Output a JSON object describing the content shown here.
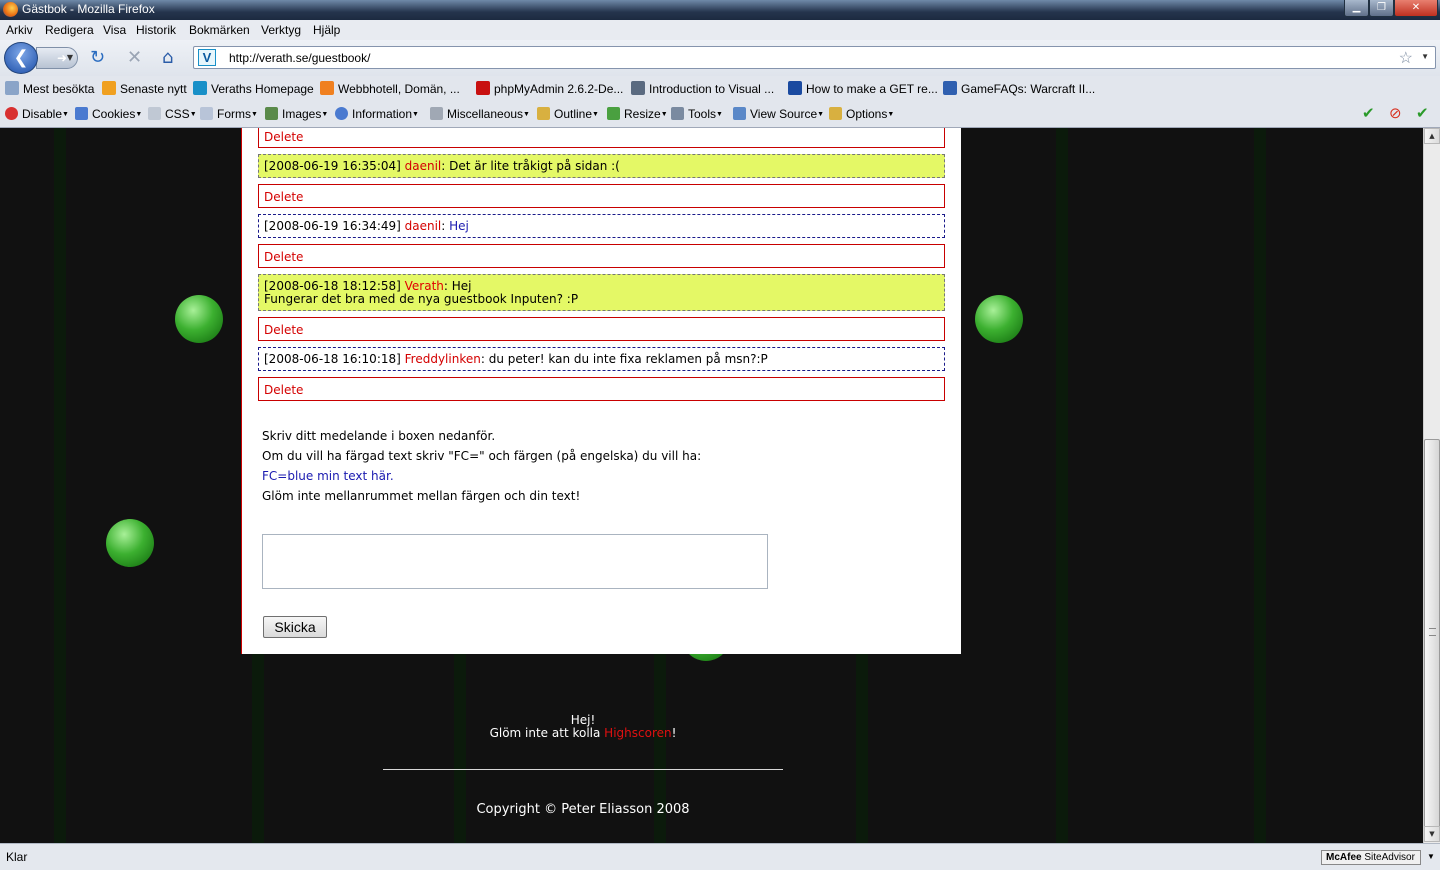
{
  "window": {
    "title": "Gästbok - Mozilla Firefox"
  },
  "menu": [
    "Arkiv",
    "Redigera",
    "Visa",
    "Historik",
    "Bokmärken",
    "Verktyg",
    "Hjälp"
  ],
  "nav": {
    "url": "http://verath.se/guestbook/"
  },
  "bookmarks": [
    "Mest besökta",
    "Senaste nytt",
    "Veraths Homepage",
    "Webbhotell, Domän, ...",
    "phpMyAdmin 2.6.2-De...",
    "Introduction to Visual ...",
    "How to make a GET re...",
    "GameFAQs: Warcraft II..."
  ],
  "devtoolbar": [
    "Disable",
    "Cookies",
    "CSS",
    "Forms",
    "Images",
    "Information",
    "Miscellaneous",
    "Outline",
    "Resize",
    "Tools",
    "View Source",
    "Options"
  ],
  "guestbook": {
    "delete_label": "Delete",
    "entries": [
      {
        "timestamp": "[2008-06-19 16:35:04]",
        "name": "daenil",
        "text": ": Det är lite tråkigt på sidan :("
      },
      {
        "timestamp": "[2008-06-19 16:34:49]",
        "name": "daenil",
        "sep": ": ",
        "text": "Hej"
      },
      {
        "timestamp": "[2008-06-18 18:12:58]",
        "name": "Verath",
        "text": ": Hej",
        "text2": "Fungerar det bra med de nya guestbook Inputen? :P"
      },
      {
        "timestamp": "[2008-06-18 16:10:18]",
        "name": "Freddylinken",
        "text": ": du peter! kan du inte fixa reklamen på msn?:P"
      }
    ],
    "info": {
      "line1": "Skriv ditt medelande i boxen nedanför.",
      "line2": "Om du vill ha färgad text skriv \"FC=\" och färgen (på engelska) du vill ha:",
      "line3": "FC=blue min text här.",
      "line4": "Glöm inte mellanrummet mellan färgen och din text!"
    },
    "submit_label": "Skicka"
  },
  "footer": {
    "line1": "Hej!",
    "line2_pre": "Glöm inte att kolla ",
    "line2_link": "Highscoren",
    "line2_post": "!",
    "copyright": "Copyright © Peter Eliasson 2008"
  },
  "status": {
    "text": "Klar",
    "mcafee_brand": "McAfee",
    "mcafee_product": "SiteAdvisor"
  },
  "colors": {
    "name_red": "#d40000",
    "highlight": "#e4f866",
    "fc_blue": "#1a1ab0",
    "page_bg": "#111111",
    "ball_green": "#3cb030"
  }
}
